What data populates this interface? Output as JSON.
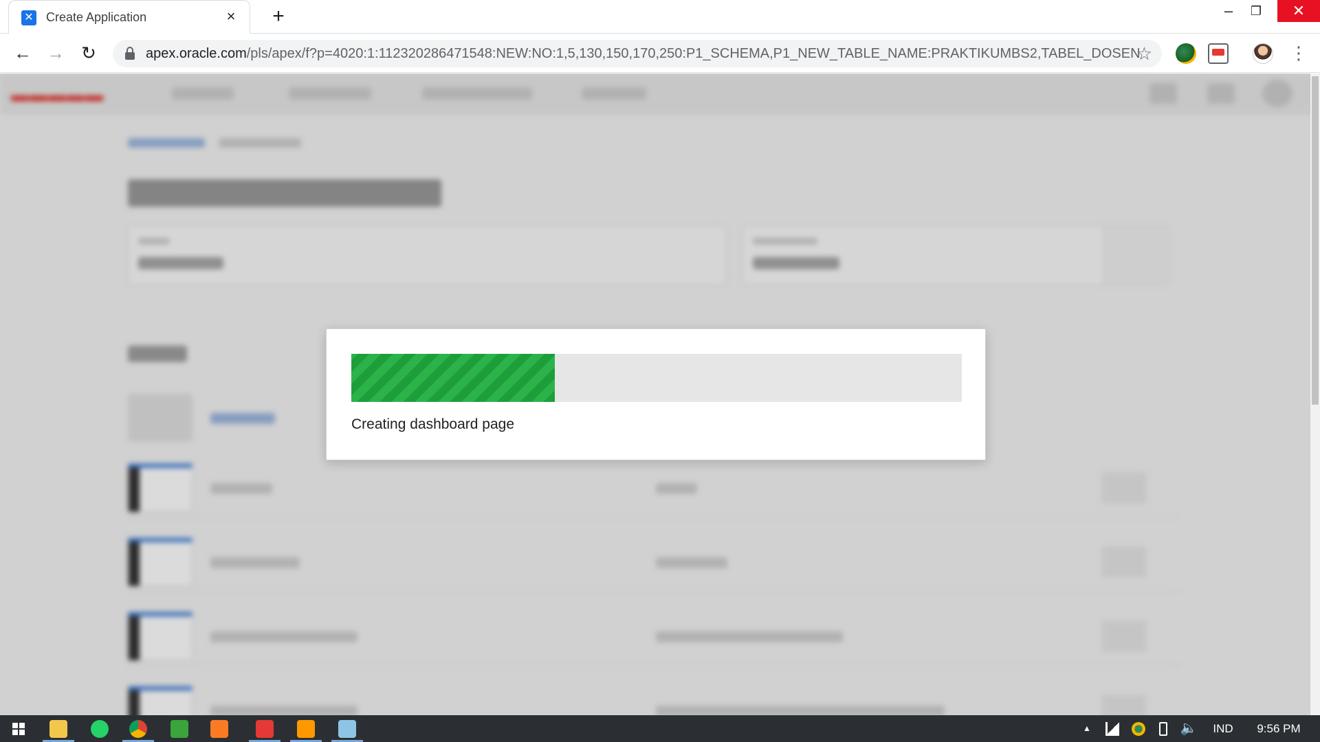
{
  "browser": {
    "tab_title": "Create Application",
    "tab_close": "×",
    "new_tab": "+",
    "window_controls": {
      "minimize": "–",
      "maximize": "❐",
      "close": "✕"
    },
    "nav": {
      "back": "←",
      "forward": "→",
      "reload": "↻"
    },
    "url_host": "apex.oracle.com",
    "url_path": "/pls/apex/f?p=4020:1:112320286471548:NEW:NO:1,5,130,150,170,250:P1_SCHEMA,P1_NEW_TABLE_NAME:PRAKTIKUMBS2,TABEL_DOSEN",
    "bookmark_star": "☆",
    "menu": "⋮",
    "extensions": [
      "globe-extension-icon",
      "cast-extension-icon",
      "profile-avatar"
    ]
  },
  "dialog": {
    "progress_fraction": 0.333,
    "progress_label": "Creating dashboard page",
    "progress_color": "#1e9e3a"
  },
  "taskbar": {
    "apps": [
      "file-explorer-icon",
      "whatsapp-icon",
      "chrome-icon",
      "camtasia-icon",
      "xampp-icon",
      "red-app-icon",
      "sublime-text-icon",
      "notepad-icon"
    ],
    "tray": {
      "language": "IND",
      "time": "9:56 PM",
      "overflow": "▲"
    }
  },
  "colors": {
    "accent": "#1a73e8",
    "progress_green": "#1e9e3a",
    "close_red": "#e81123",
    "taskbar_bg": "#2b2f33"
  }
}
